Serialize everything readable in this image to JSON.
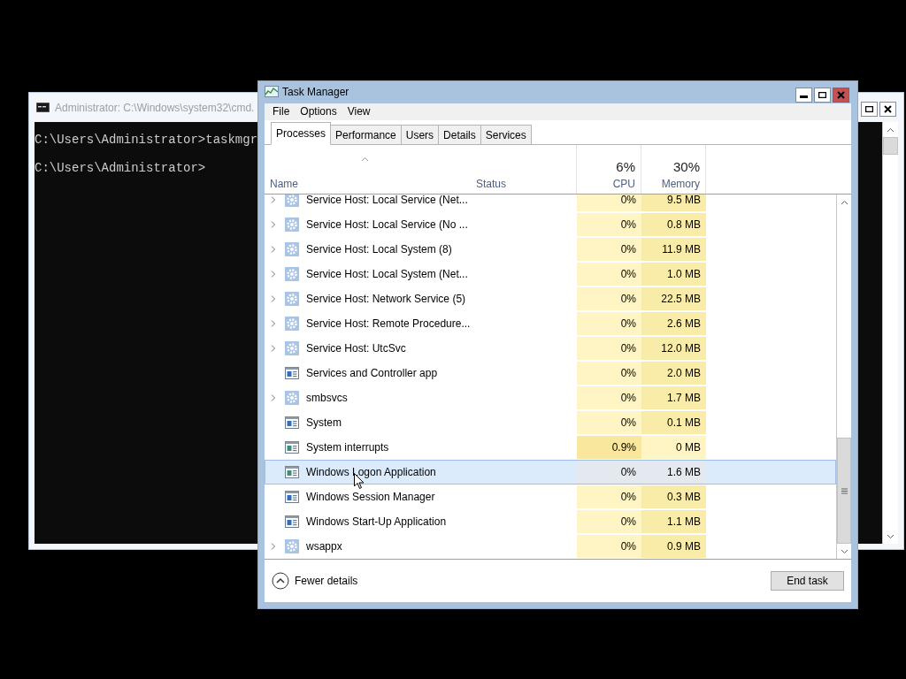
{
  "console_window": {
    "title": "Administrator: C:\\Windows\\system32\\cmd.",
    "lines": [
      "C:\\Users\\Administrator>taskmgr",
      "C:\\Users\\Administrator>"
    ]
  },
  "task_manager": {
    "title": "Task Manager",
    "menu": [
      "File",
      "Options",
      "View"
    ],
    "tabs": [
      {
        "label": "Processes",
        "selected": true
      },
      {
        "label": "Performance",
        "selected": false
      },
      {
        "label": "Users",
        "selected": false
      },
      {
        "label": "Details",
        "selected": false
      },
      {
        "label": "Services",
        "selected": false
      }
    ],
    "columns": [
      {
        "label": "Name",
        "sorted": true
      },
      {
        "label": "Status",
        "sorted": false
      },
      {
        "label": "CPU",
        "total": "6%",
        "sorted": false
      },
      {
        "label": "Memory",
        "total": "30%",
        "sorted": false
      }
    ],
    "rows": [
      {
        "name": "Service Host: Local Service (Net...",
        "kind": "service",
        "expandable": true,
        "cpu": "0%",
        "memory": "9.5 MB",
        "selected": false
      },
      {
        "name": "Service Host: Local Service (No ...",
        "kind": "service",
        "expandable": true,
        "cpu": "0%",
        "memory": "0.8 MB",
        "selected": false
      },
      {
        "name": "Service Host: Local System (8)",
        "kind": "service",
        "expandable": true,
        "cpu": "0%",
        "memory": "11.9 MB",
        "selected": false
      },
      {
        "name": "Service Host: Local System (Net...",
        "kind": "service",
        "expandable": true,
        "cpu": "0%",
        "memory": "1.0 MB",
        "selected": false
      },
      {
        "name": "Service Host: Network Service (5)",
        "kind": "service",
        "expandable": true,
        "cpu": "0%",
        "memory": "22.5 MB",
        "selected": false
      },
      {
        "name": "Service Host: Remote Procedure...",
        "kind": "service",
        "expandable": true,
        "cpu": "0%",
        "memory": "2.6 MB",
        "selected": false
      },
      {
        "name": "Service Host: UtcSvc",
        "kind": "service",
        "expandable": true,
        "cpu": "0%",
        "memory": "12.0 MB",
        "selected": false
      },
      {
        "name": "Services and Controller app",
        "kind": "app",
        "expandable": false,
        "cpu": "0%",
        "memory": "2.0 MB",
        "selected": false
      },
      {
        "name": "smbsvcs",
        "kind": "service",
        "expandable": true,
        "cpu": "0%",
        "memory": "1.7 MB",
        "selected": false
      },
      {
        "name": "System",
        "kind": "app",
        "expandable": false,
        "cpu": "0%",
        "memory": "0.1 MB",
        "selected": false
      },
      {
        "name": "System interrupts",
        "kind": "system",
        "expandable": false,
        "cpu": "0.9%",
        "memory": "0 MB",
        "selected": false
      },
      {
        "name": "Windows Logon Application",
        "kind": "system",
        "expandable": false,
        "cpu": "0%",
        "memory": "1.6 MB",
        "selected": true
      },
      {
        "name": "Windows Session Manager",
        "kind": "app",
        "expandable": false,
        "cpu": "0%",
        "memory": "0.3 MB",
        "selected": false
      },
      {
        "name": "Windows Start-Up Application",
        "kind": "app",
        "expandable": false,
        "cpu": "0%",
        "memory": "1.1 MB",
        "selected": false
      },
      {
        "name": "wsappx",
        "kind": "service",
        "expandable": true,
        "cpu": "0%",
        "memory": "0.9 MB",
        "selected": false
      }
    ],
    "footer": {
      "toggle": "Fewer details",
      "button": "End task"
    }
  }
}
